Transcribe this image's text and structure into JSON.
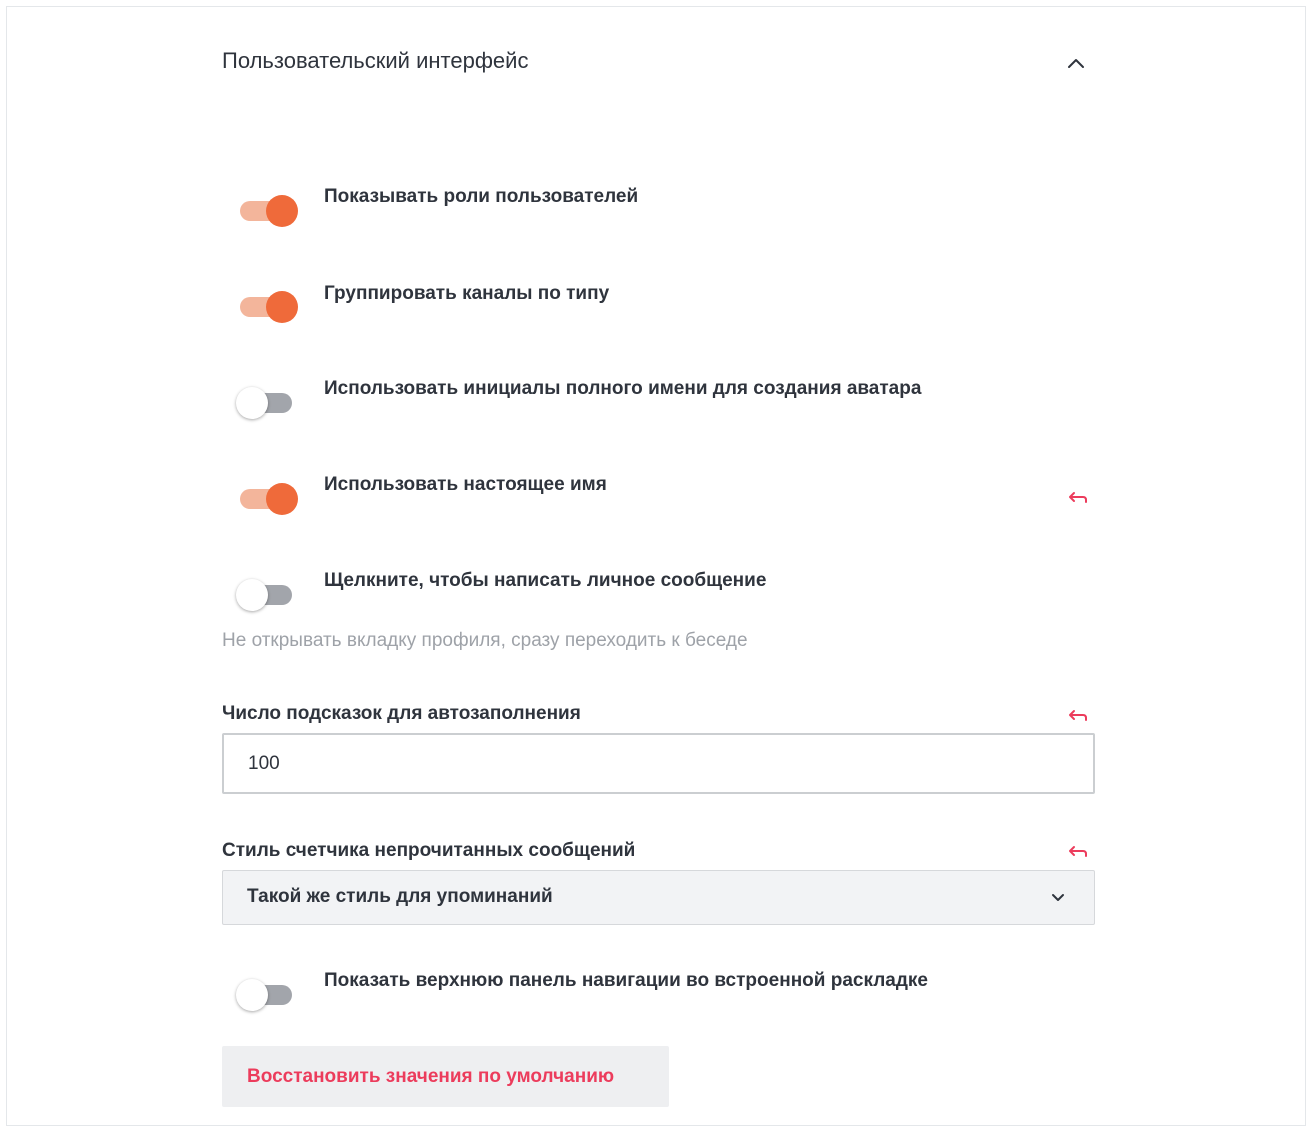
{
  "section": {
    "title": "Пользовательский интерфейс",
    "expanded": true
  },
  "colors": {
    "accent": "#ef6a3a",
    "accent_track": "#f3b59b",
    "danger": "#ec3c5c",
    "off_track": "#a2a5ab"
  },
  "settings": [
    {
      "label": "Показывать роли пользователей",
      "enabled": true,
      "changed": false
    },
    {
      "label": "Группировать каналы по типу",
      "enabled": true,
      "changed": false
    },
    {
      "label": "Использовать инициалы полного имени для создания аватара",
      "enabled": false,
      "changed": false
    },
    {
      "label": "Использовать настоящее имя",
      "enabled": true,
      "changed": true
    },
    {
      "label": "Щелкните, чтобы написать личное сообщение",
      "enabled": false,
      "changed": false,
      "hint": "Не открывать вкладку профиля, сразу переходить к беседе"
    }
  ],
  "autocomplete": {
    "label": "Число подсказок для автозаполнения",
    "value": "100"
  },
  "unread_counter": {
    "label": "Стиль счетчика непрочитанных сообщений",
    "selected": "Такой же стиль для упоминаний"
  },
  "top_nav": {
    "label": "Показать верхнюю панель навигации во встроенной раскладке",
    "enabled": false
  },
  "icons": {
    "collapse": "chevron-up-icon",
    "reset": "undo-arrow-icon",
    "dropdown": "chevron-down-icon"
  },
  "reset_button": {
    "label": "Восстановить значения по умолчанию"
  }
}
